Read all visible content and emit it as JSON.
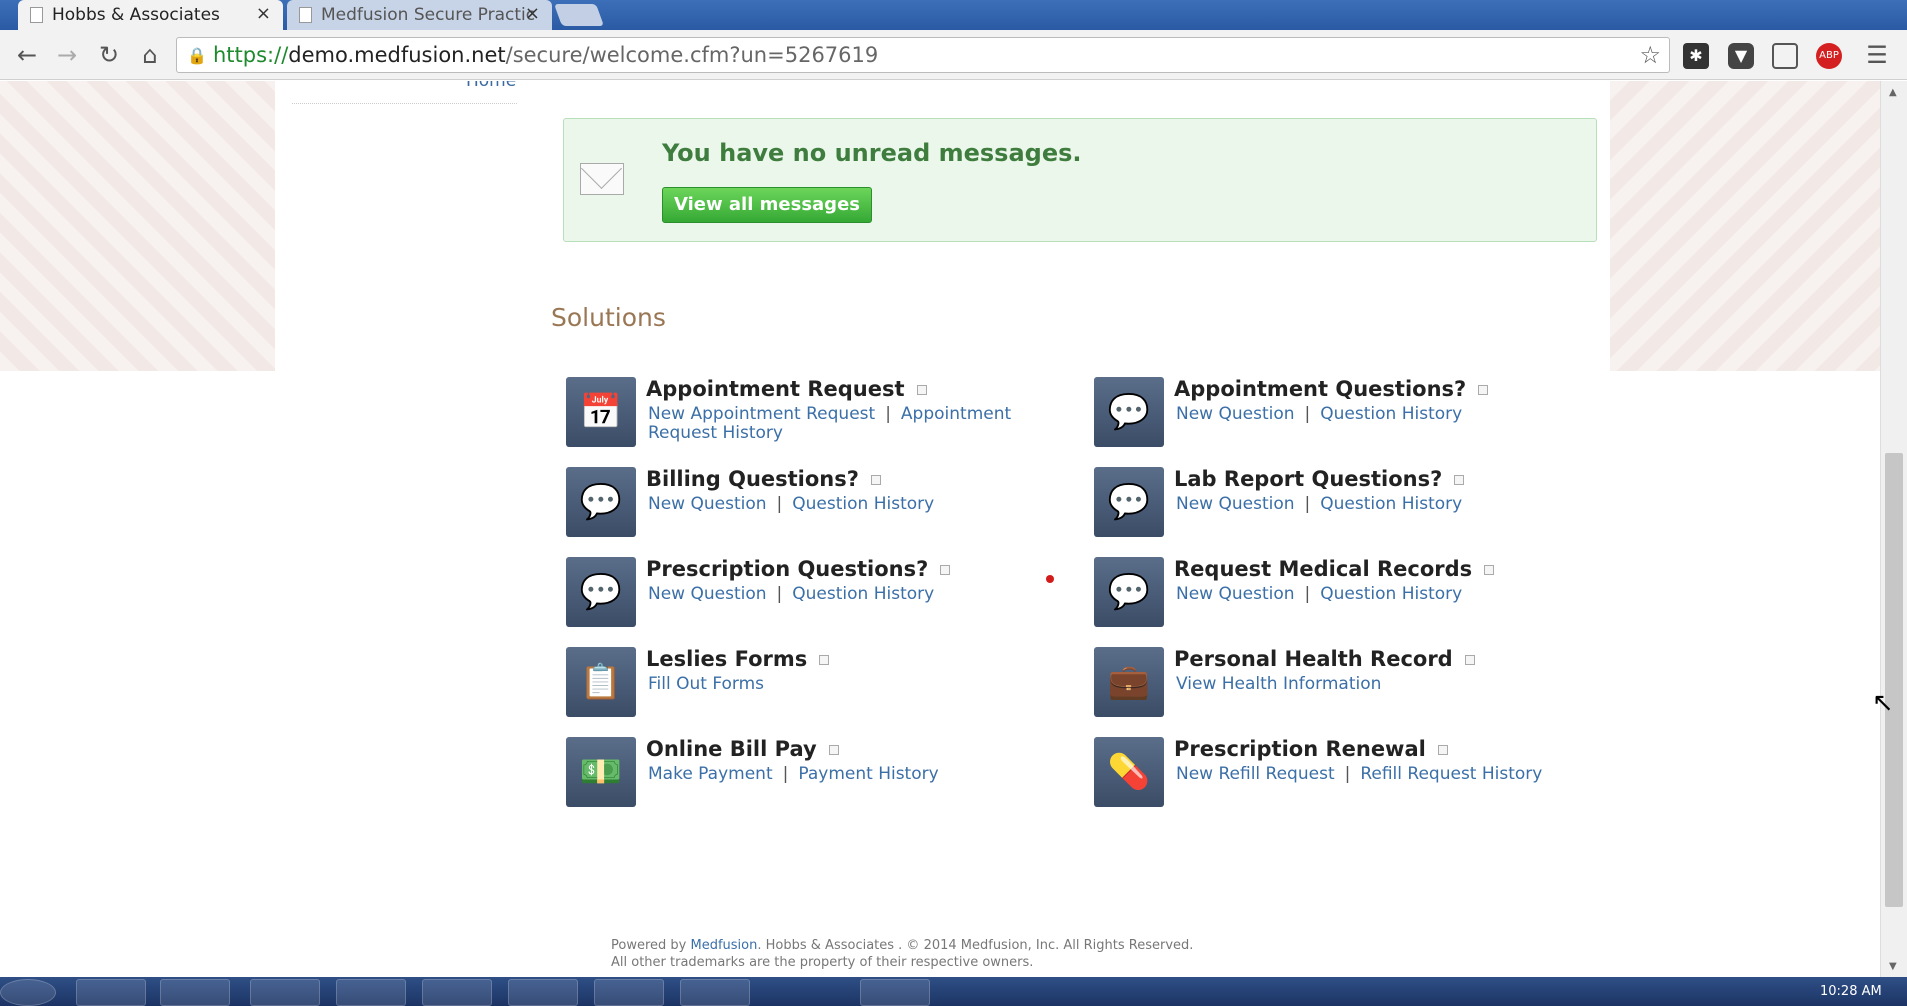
{
  "browser": {
    "tabs": [
      {
        "title": "Hobbs & Associates",
        "close": "×"
      },
      {
        "title": "Medfusion Secure Practic",
        "close": "×"
      }
    ],
    "url_https": "https://",
    "url_host": "demo.medfusion.net",
    "url_path": "/secure/welcome.cfm?un=5267619",
    "extensions": [
      "ABP"
    ]
  },
  "nav": {
    "home_link": "Home"
  },
  "messages": {
    "title": "You have no unread messages.",
    "button": "View all messages"
  },
  "solutions": {
    "heading": "Solutions",
    "items": [
      {
        "title": "Appointment Request",
        "icon": "calendar-icon",
        "links": [
          "New Appointment Request",
          "Appointment Request History"
        ]
      },
      {
        "title": "Appointment Questions?",
        "icon": "chat-bubbles-icon",
        "links": [
          "New Question",
          "Question History"
        ]
      },
      {
        "title": "Billing Questions?",
        "icon": "chat-bubbles-icon",
        "links": [
          "New Question",
          "Question History"
        ]
      },
      {
        "title": "Lab Report Questions?",
        "icon": "chat-bubbles-icon",
        "links": [
          "New Question",
          "Question History"
        ]
      },
      {
        "title": "Prescription Questions?",
        "icon": "chat-bubbles-icon",
        "links": [
          "New Question",
          "Question History"
        ]
      },
      {
        "title": "Request Medical Records",
        "icon": "chat-bubbles-icon",
        "links": [
          "New Question",
          "Question History"
        ]
      },
      {
        "title": "Leslies Forms",
        "icon": "clipboard-icon",
        "links": [
          "Fill Out Forms"
        ]
      },
      {
        "title": "Personal Health Record",
        "icon": "medical-record-icon",
        "links": [
          "View Health Information"
        ]
      },
      {
        "title": "Online Bill Pay",
        "icon": "money-icon",
        "links": [
          "Make Payment",
          "Payment History"
        ]
      },
      {
        "title": "Prescription Renewal",
        "icon": "pill-icon",
        "links": [
          "New Refill Request",
          "Refill Request History"
        ]
      }
    ]
  },
  "footer": {
    "powered_by": "Powered by",
    "brand": "Medfusion",
    "line1_rest": ". Hobbs & Associates . © 2014 Medfusion, Inc. All Rights Reserved.",
    "line2": "All other trademarks are the property of their respective owners."
  },
  "taskbar": {
    "clock": "10:28 AM"
  }
}
